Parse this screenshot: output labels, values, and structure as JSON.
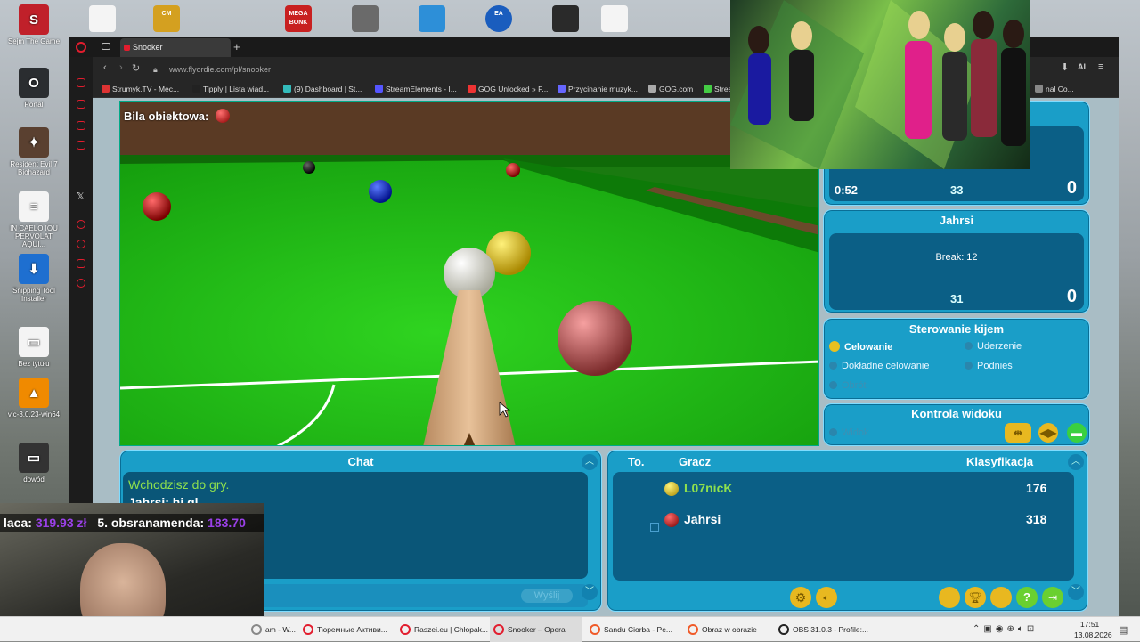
{
  "desktop": {
    "left_icons": [
      {
        "label": "Sejm The Game",
        "glyph": "S",
        "color": "#c0202a"
      },
      {
        "label": "Portal",
        "glyph": "O",
        "color": "#2a2d30"
      },
      {
        "label": "Resident Evil 7 Biohazard",
        "glyph": "✦",
        "color": "#5a4030"
      },
      {
        "label": "IN CAELO IOU PERVOLAT AQUI...",
        "glyph": "≡",
        "color": "#f4f4f4"
      },
      {
        "label": "Snipping Tool Installer",
        "glyph": "⬇",
        "color": "#1e6fd0"
      },
      {
        "label": "Bez tytułu",
        "glyph": "▭",
        "color": "#f4f4f4"
      },
      {
        "label": "vlc-3.0.23-win64",
        "glyph": "▲",
        "color": "#f08a00"
      },
      {
        "label": "dowód",
        "glyph": "▭",
        "color": "#333"
      }
    ],
    "top_icons": [
      {
        "name": "file-icon",
        "glyph": "",
        "color": "#f4f4f4"
      },
      {
        "name": "car-mechanic-icon",
        "glyph": "CM",
        "color": "#d4a020"
      },
      {
        "name": "mega-bonk-icon",
        "glyph": "MEGA BONK",
        "color": "#c82020"
      },
      {
        "name": "photo-icon",
        "glyph": "",
        "color": "#6a6a6a"
      },
      {
        "name": "map-icon",
        "glyph": "",
        "color": "#2d8fd8"
      },
      {
        "name": "ea-icon",
        "glyph": "EA",
        "color": "#1a5dbe"
      },
      {
        "name": "obs-icon",
        "glyph": "",
        "color": "#2a2a2a"
      },
      {
        "name": "file2-icon",
        "glyph": "",
        "color": "#f4f4f4"
      }
    ]
  },
  "browser": {
    "tab_title": "Snooker",
    "new_tab": "+",
    "url": "www.flyordie.com/pl/snooker",
    "bookmarks": [
      {
        "label": "Strumyk.TV - Mec...",
        "color": "#d33"
      },
      {
        "label": "Tipply | Lista wiad...",
        "color": "#222"
      },
      {
        "label": "(9) Dashboard | St...",
        "color": "#3bb"
      },
      {
        "label": "StreamElements - I...",
        "color": "#55f"
      },
      {
        "label": "GOG Unlocked » F...",
        "color": "#e33"
      },
      {
        "label": "Przycinanie muzyk...",
        "color": "#66f"
      },
      {
        "label": "GOG.com",
        "color": "#aaa"
      },
      {
        "label": "Strea",
        "color": "#4c4"
      },
      {
        "label": "nal Co...",
        "color": "#888"
      }
    ]
  },
  "game": {
    "object_ball_label": "Bila obiektowa:",
    "object_ball_color": "#cc1010"
  },
  "players": {
    "p1": {
      "time": "0:52",
      "remaining": "33",
      "score": "0"
    },
    "p2": {
      "name": "Jahrsi",
      "break_text": "Break: 12",
      "remaining": "31",
      "score": "0"
    }
  },
  "cue_control": {
    "title": "Sterowanie kijem",
    "options": {
      "aim": "Celowanie",
      "strike": "Uderzenie",
      "fine_aim": "Dokładne celowanie",
      "raise": "Podnieś",
      "spin": "Obrót"
    }
  },
  "view_control": {
    "title": "Kontrola widoku",
    "view": "Widok"
  },
  "chat": {
    "title": "Chat",
    "messages": [
      "Wchodzisz do gry.",
      "Jahrsi: hi gl"
    ],
    "send_label": "Wyślij"
  },
  "ranking": {
    "col_to": "To.",
    "col_player": "Gracz",
    "col_rating": "Klasyfikacja",
    "rows": [
      {
        "name": "L07nicK",
        "rating": "176",
        "ball_color": "#d8c010"
      },
      {
        "name": "Jahrsi",
        "rating": "318",
        "ball_color": "#b00e0e"
      }
    ]
  },
  "stream": {
    "donation_1_name": "laca:",
    "donation_1_amount": "319.93 zł",
    "donation_2_name": "5. obsranamenda:",
    "donation_2_amount": "183.70"
  },
  "taskbar": {
    "items": [
      {
        "label": "am - W...",
        "color": "#888"
      },
      {
        "label": "Тюремные Активи...",
        "color": "#e21d2e"
      },
      {
        "label": "Raszei.eu | Chłopak...",
        "color": "#e21d2e"
      },
      {
        "label": "Snooker – Opera",
        "color": "#e21d2e"
      },
      {
        "label": "Sandu Ciorba - Pe...",
        "color": "#f05a28"
      },
      {
        "label": "Obraz w obrazie",
        "color": "#f05a28"
      },
      {
        "label": "OBS 31.0.3 - Profile:...",
        "color": "#222"
      }
    ],
    "time": "17:51",
    "date": "13.08.2026"
  }
}
